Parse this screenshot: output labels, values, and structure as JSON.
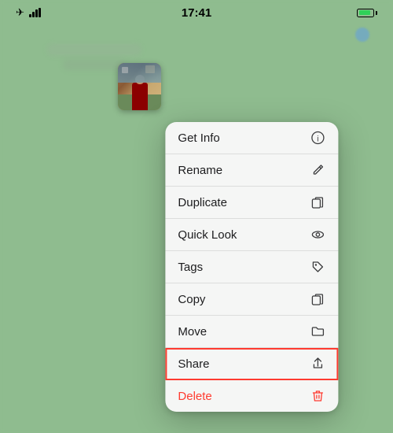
{
  "statusBar": {
    "time": "17:41",
    "batteryLevel": 85
  },
  "contextMenu": {
    "items": [
      {
        "id": "get-info",
        "label": "Get Info",
        "icon": "info-circle"
      },
      {
        "id": "rename",
        "label": "Rename",
        "icon": "pencil"
      },
      {
        "id": "duplicate",
        "label": "Duplicate",
        "icon": "duplicate"
      },
      {
        "id": "quick-look",
        "label": "Quick Look",
        "icon": "eye"
      },
      {
        "id": "tags",
        "label": "Tags",
        "icon": "tag"
      },
      {
        "id": "copy",
        "label": "Copy",
        "icon": "copy"
      },
      {
        "id": "move",
        "label": "Move",
        "icon": "folder"
      },
      {
        "id": "share",
        "label": "Share",
        "icon": "share",
        "highlighted": true
      },
      {
        "id": "delete",
        "label": "Delete",
        "icon": "trash",
        "destructive": true
      }
    ]
  }
}
